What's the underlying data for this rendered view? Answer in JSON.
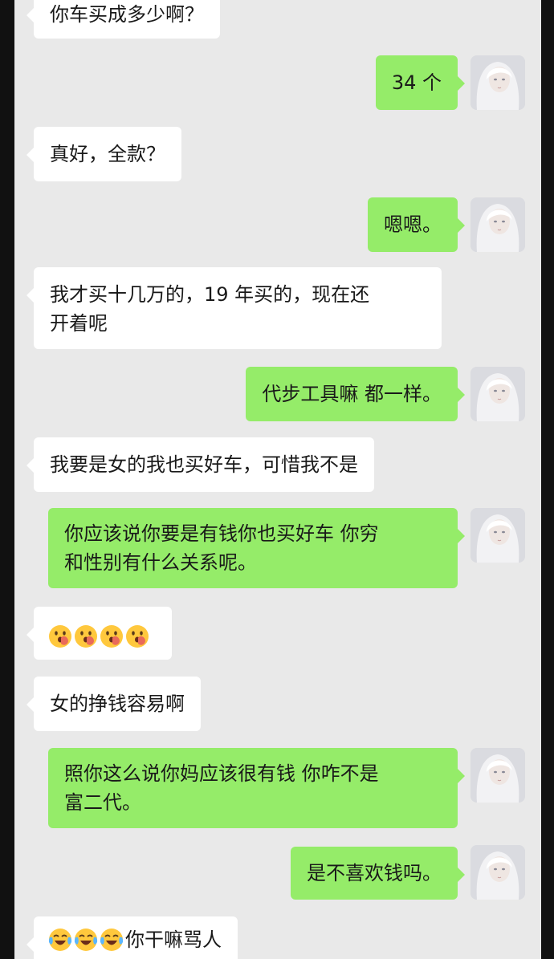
{
  "messages": [
    {
      "side": "left",
      "text": "你车买成多少啊？"
    },
    {
      "side": "right",
      "text": "34 个"
    },
    {
      "side": "left",
      "text": "真好，全款？"
    },
    {
      "side": "right",
      "text": "嗯嗯。"
    },
    {
      "side": "left",
      "line1": "我才买十几万的，19 年买的，现在还",
      "line2": "开着呢"
    },
    {
      "side": "right",
      "text": "代步工具嘛 都一样。"
    },
    {
      "side": "left",
      "text": "我要是女的我也买好车，可惜我不是"
    },
    {
      "side": "right",
      "line1": "你应该说你要是有钱你也买好车 你穷",
      "line2": "和性别有什么关系呢。"
    },
    {
      "side": "left",
      "emoji": "hand-over-mouth-emoji",
      "emoji_count": 4
    },
    {
      "side": "left",
      "text": "女的挣钱容易啊"
    },
    {
      "side": "right",
      "line1": "照你这么说你妈应该很有钱 你咋不是",
      "line2": "富二代。"
    },
    {
      "side": "right",
      "text": "是不喜欢钱吗。"
    },
    {
      "side": "left",
      "emoji": "tears-of-joy-emoji",
      "emoji_count": 3,
      "text": "你干嘛骂人"
    }
  ],
  "colors": {
    "background": "#e9e9e9",
    "left_bubble": "#ffffff",
    "right_bubble": "#95ec69",
    "text": "#191919"
  },
  "icons": {
    "back": "back-chevron-icon",
    "avatar": "user-avatar"
  }
}
